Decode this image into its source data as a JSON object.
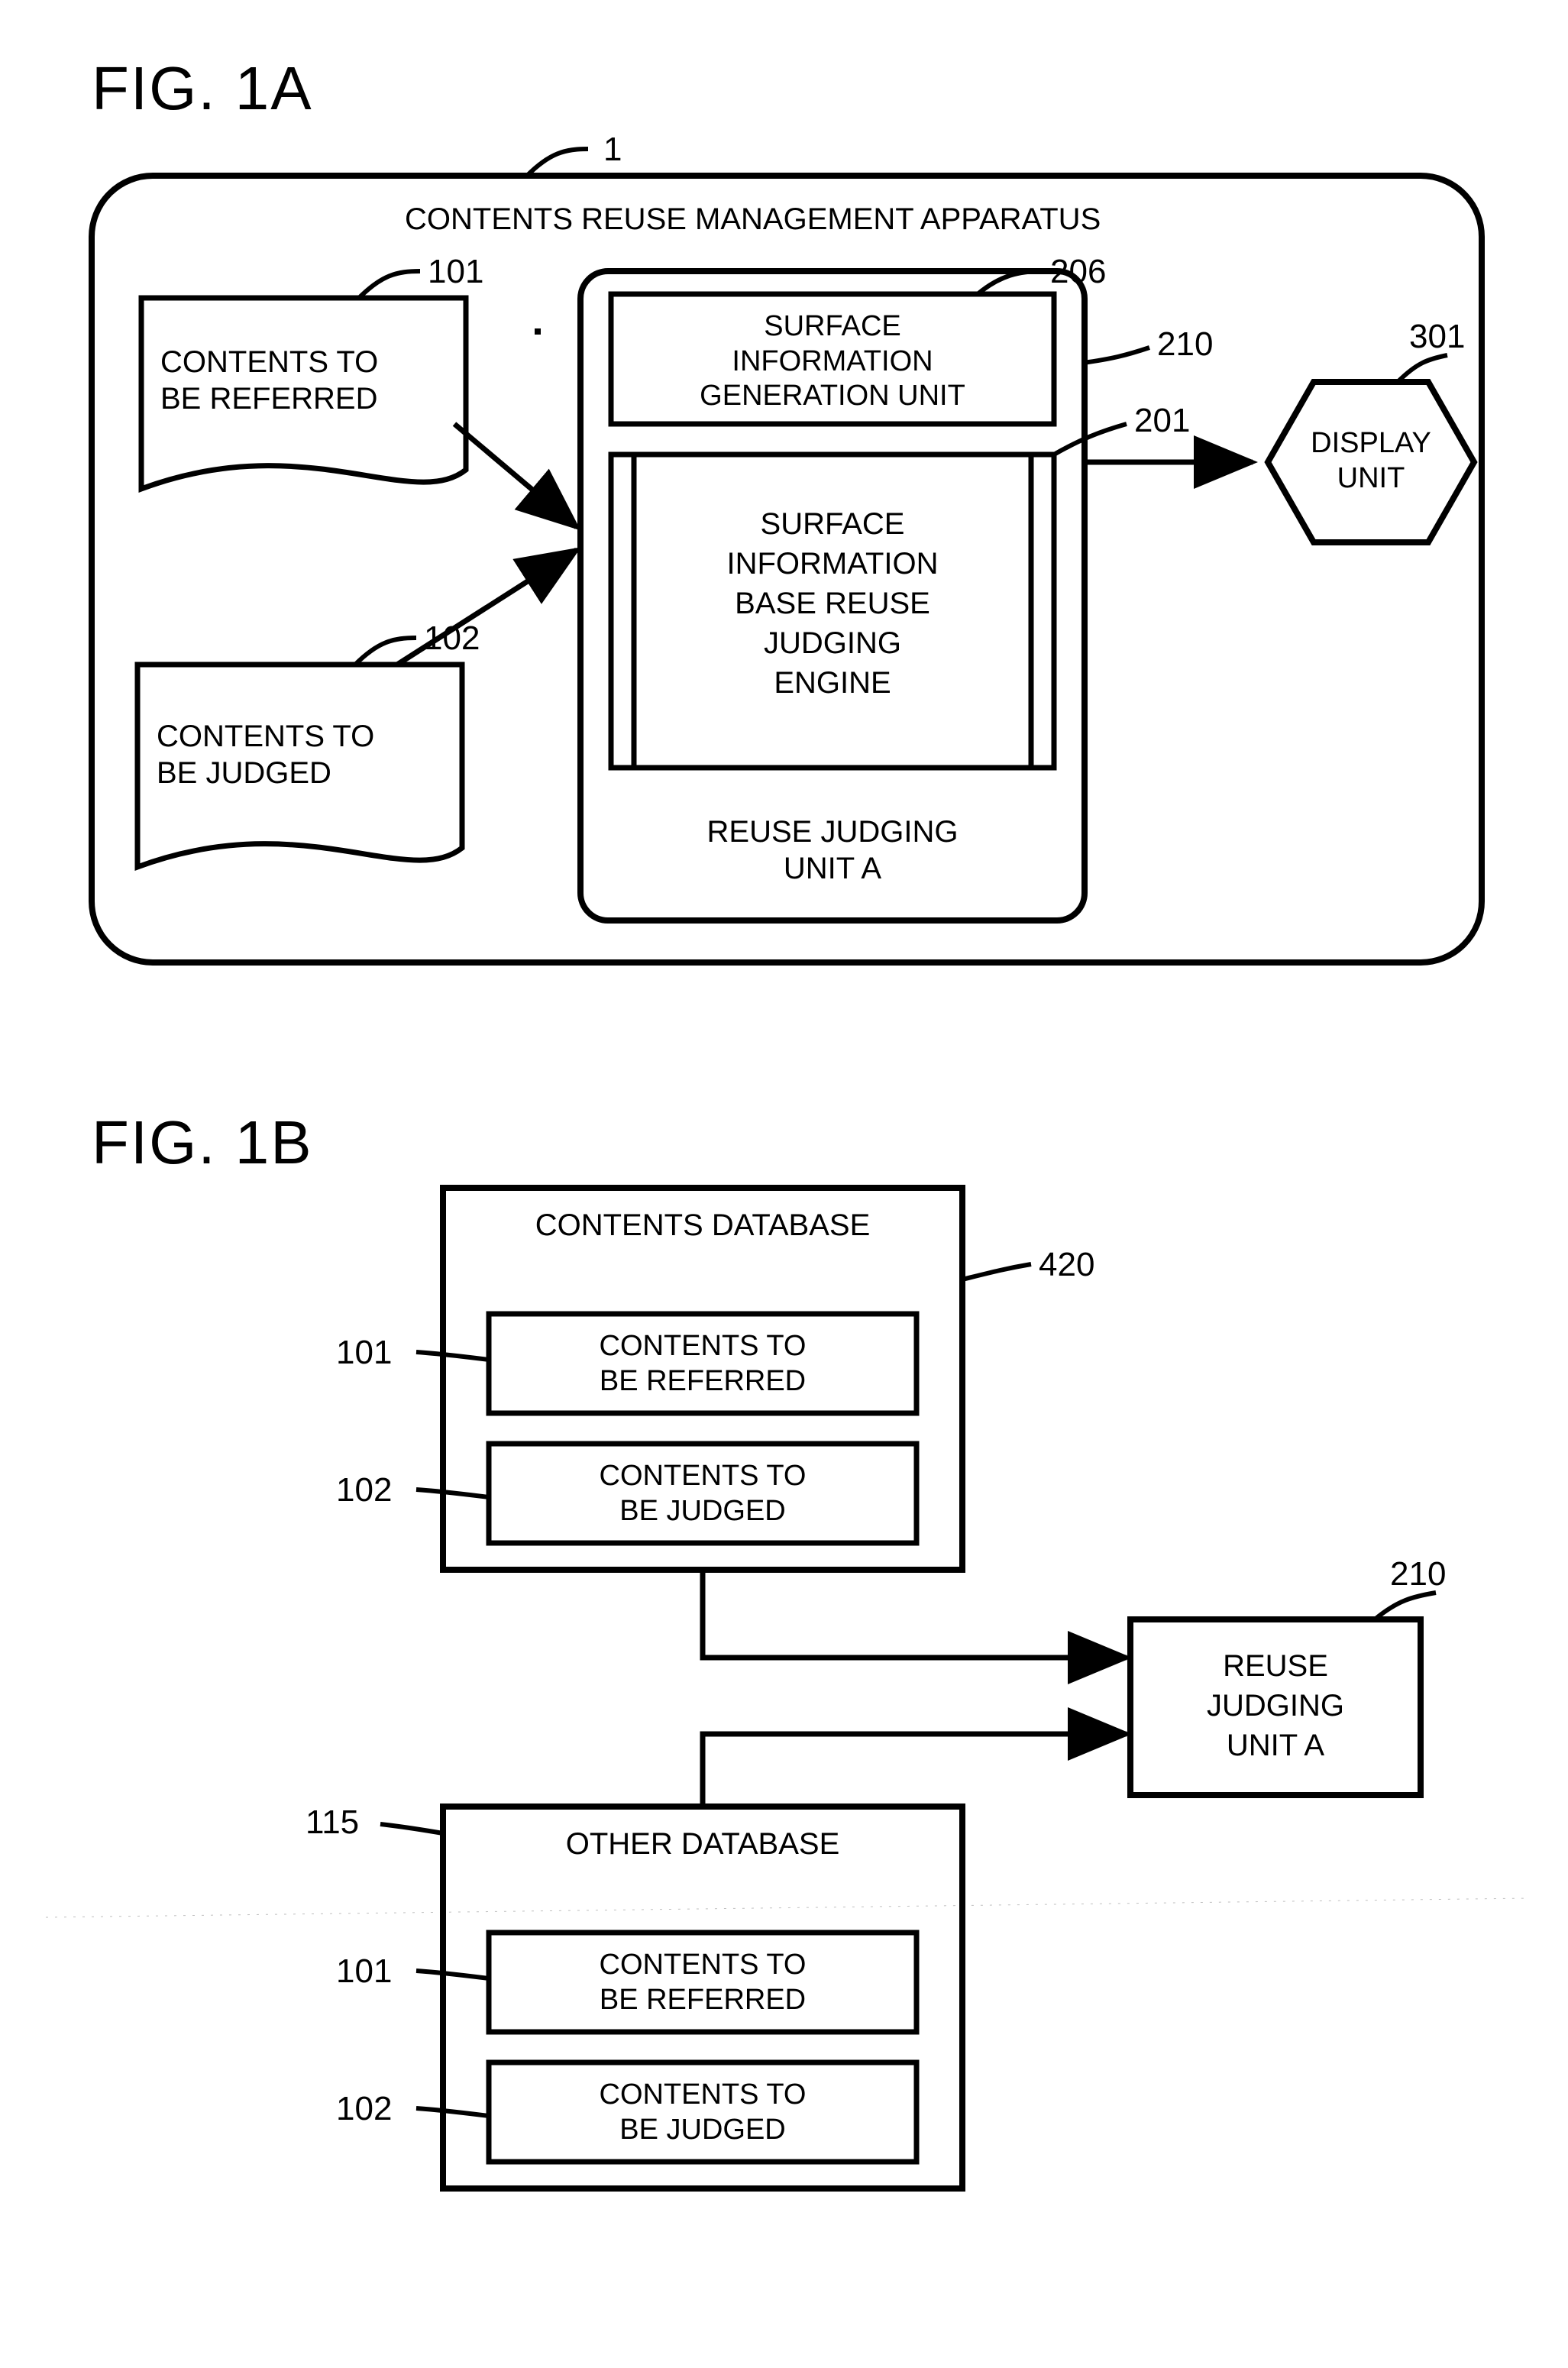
{
  "figA": {
    "title": "FIG. 1A",
    "apparatus_label": "CONTENTS REUSE MANAGEMENT APPARATUS",
    "ref_1": "1",
    "ref_101": "101",
    "ref_102": "102",
    "ref_206": "206",
    "ref_210": "210",
    "ref_201": "201",
    "ref_301": "301",
    "contents_referred": "CONTENTS TO\nBE REFERRED",
    "contents_judged": "CONTENTS TO\nBE JUDGED",
    "surface_gen": "SURFACE\nINFORMATION\nGENERATION UNIT",
    "surface_engine": "SURFACE\nINFORMATION\nBASE REUSE\nJUDGING\nENGINE",
    "reuse_unit": "REUSE JUDGING\nUNIT A",
    "display_unit": "DISPLAY\nUNIT"
  },
  "figB": {
    "title": "FIG. 1B",
    "contents_db": "CONTENTS DATABASE",
    "other_db": "OTHER DATABASE",
    "ref_420": "420",
    "ref_101": "101",
    "ref_102": "102",
    "ref_210": "210",
    "ref_115": "115",
    "contents_referred": "CONTENTS TO\nBE REFERRED",
    "contents_judged": "CONTENTS TO\nBE JUDGED",
    "reuse_unit": "REUSE\nJUDGING\nUNIT A"
  }
}
